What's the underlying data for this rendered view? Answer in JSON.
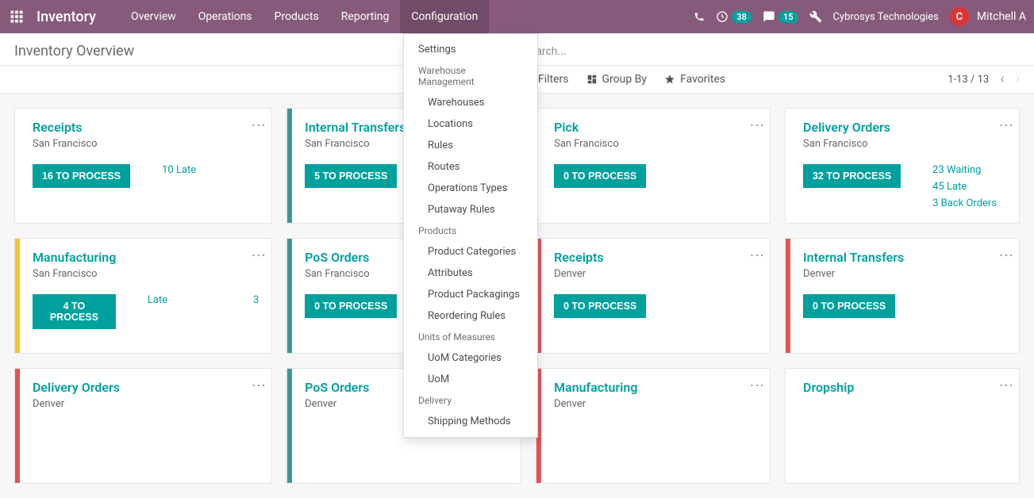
{
  "app_name": "Inventory",
  "nav": {
    "overview": "Overview",
    "operations": "Operations",
    "products": "Products",
    "reporting": "Reporting",
    "configuration": "Configuration"
  },
  "topbar": {
    "activity_badge": "38",
    "discuss_badge": "15",
    "company": "Cybrosys Technologies",
    "user": "Mitchell A",
    "avatar_letter": "C"
  },
  "page_title": "Inventory Overview",
  "search": {
    "placeholder": "Search..."
  },
  "list_controls": {
    "filters": "Filters",
    "group_by": "Group By",
    "favorites": "Favorites",
    "pager": "1-13 / 13"
  },
  "dropdown": {
    "settings": "Settings",
    "warehouse_header": "Warehouse Management",
    "warehouses": "Warehouses",
    "locations": "Locations",
    "rules": "Rules",
    "routes": "Routes",
    "op_types": "Operations Types",
    "putaway": "Putaway Rules",
    "products_header": "Products",
    "product_categories": "Product Categories",
    "attributes": "Attributes",
    "packagings": "Product Packagings",
    "reordering": "Reordering Rules",
    "uom_header": "Units of Measures",
    "uom_categories": "UoM Categories",
    "uom": "UoM",
    "delivery_header": "Delivery",
    "shipping_methods": "Shipping Methods"
  },
  "cards": [
    {
      "title": "Receipts",
      "sub": "San Francisco",
      "button": "16 TO PROCESS",
      "stripe": "",
      "stats": [
        "10 Late"
      ]
    },
    {
      "title": "Internal Transfers",
      "sub": "San Francisco",
      "button": "5 TO PROCESS",
      "stripe": "#3d9994",
      "stats": []
    },
    {
      "title": "Pick",
      "sub": "San Francisco",
      "button": "0 TO PROCESS",
      "stripe": "",
      "stats": []
    },
    {
      "title": "Delivery Orders",
      "sub": "San Francisco",
      "button": "32 TO PROCESS",
      "stripe": "",
      "stats": [
        "23 Waiting",
        "45 Late",
        "3 Back Orders"
      ]
    },
    {
      "title": "Manufacturing",
      "sub": "San Francisco",
      "button": "4 TO PROCESS",
      "stripe": "#f4c430",
      "stats": [],
      "late_label": "Late",
      "late_count": "3"
    },
    {
      "title": "PoS Orders",
      "sub": "San Francisco",
      "button": "0 TO PROCESS",
      "stripe": "#3d9994",
      "stats": []
    },
    {
      "title": "Receipts",
      "sub": "Denver",
      "button": "0 TO PROCESS",
      "stripe": "#e55353",
      "stats": []
    },
    {
      "title": "Internal Transfers",
      "sub": "Denver",
      "button": "0 TO PROCESS",
      "stripe": "#e55353",
      "stats": []
    },
    {
      "title": "Delivery Orders",
      "sub": "Denver",
      "button": "",
      "stripe": "#e55353",
      "stats": []
    },
    {
      "title": "PoS Orders",
      "sub": "Denver",
      "button": "",
      "stripe": "#3d9994",
      "stats": []
    },
    {
      "title": "Manufacturing",
      "sub": "Denver",
      "button": "",
      "stripe": "#e55353",
      "stats": []
    },
    {
      "title": "Dropship",
      "sub": "",
      "button": "",
      "stripe": "",
      "stats": []
    }
  ]
}
